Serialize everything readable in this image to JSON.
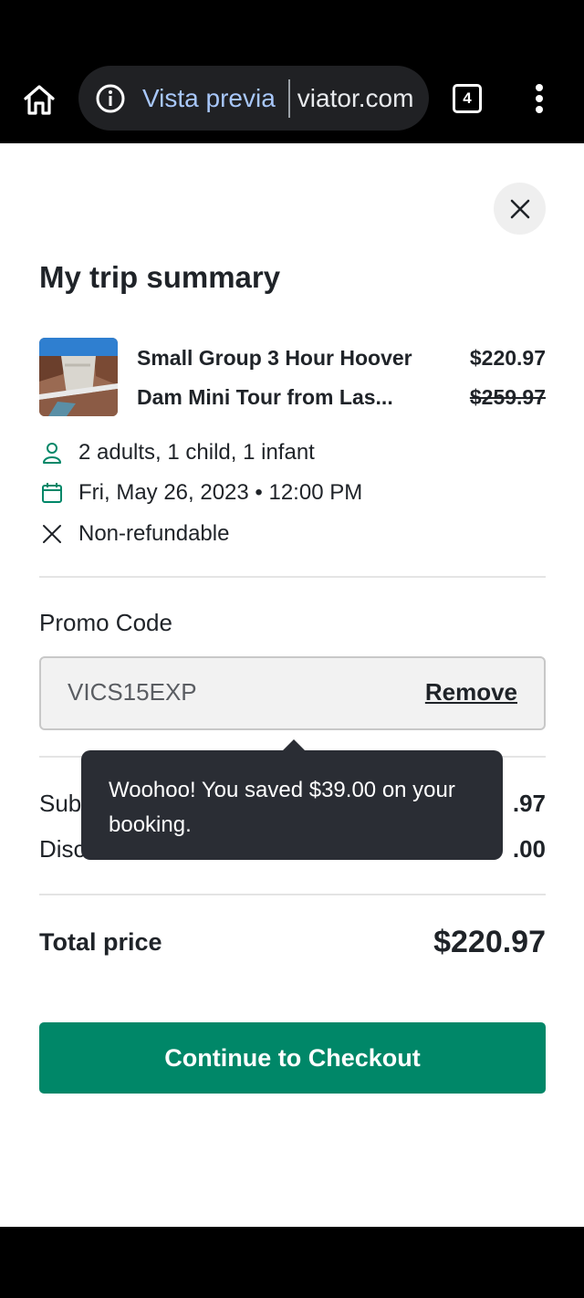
{
  "browser": {
    "preview_label": "Vista previa",
    "url": "viator.com",
    "tab_count": "4"
  },
  "summary": {
    "title": "My trip summary",
    "product": {
      "name": "Small Group 3 Hour Hoover Dam Mini Tour from Las...",
      "price": "$220.97",
      "original_price": "$259.97"
    },
    "details": {
      "travelers": "2 adults, 1 child, 1 infant",
      "date": "Fri, May 26, 2023 • 12:00 PM",
      "refund_policy": "Non-refundable"
    },
    "promo": {
      "label": "Promo Code",
      "value": "VICS15EXP",
      "remove_label": "Remove"
    },
    "breakdown": {
      "subtotal_label": "Sub",
      "subtotal_value": ".97",
      "discount_label": "Disc",
      "discount_value": ".00"
    },
    "total": {
      "label": "Total price",
      "value": "$220.97"
    },
    "checkout_label": "Continue to Checkout",
    "tooltip": "Woohoo! You saved $39.00 on your booking."
  },
  "colors": {
    "accent": "#008768",
    "tooltip_bg": "#2a2d34",
    "preview_blue": "#a8c7fa"
  },
  "icons": [
    "home-icon",
    "info-icon",
    "tabs-icon",
    "more-vert-icon",
    "close-icon",
    "person-icon",
    "calendar-icon",
    "x-icon"
  ]
}
